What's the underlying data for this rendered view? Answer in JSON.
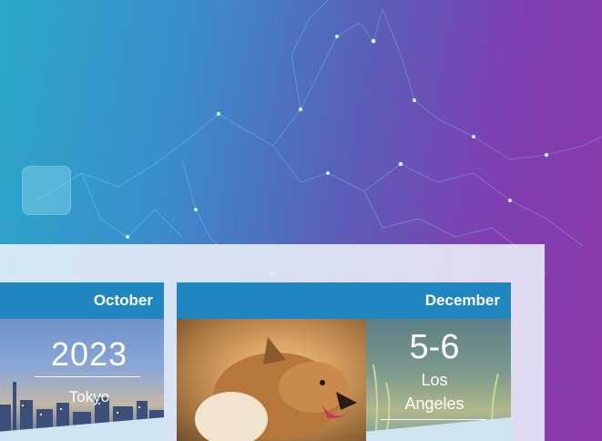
{
  "events": [
    {
      "month": "October",
      "year": "2023",
      "city": "Tokyo"
    },
    {
      "month": "December",
      "dates": "5-6",
      "city_line1": "Los",
      "city_line2": "Angeles"
    }
  ]
}
